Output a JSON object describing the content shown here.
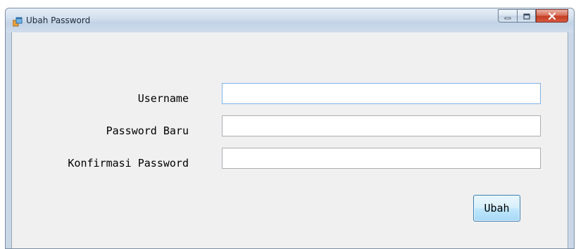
{
  "window": {
    "title": "Ubah Password",
    "icon": "app-window-icon",
    "controls": {
      "minimize_icon": "minimize-icon",
      "maximize_icon": "maximize-icon",
      "close_icon": "close-icon"
    }
  },
  "form": {
    "fields": [
      {
        "label": "Username",
        "value": "",
        "placeholder": ""
      },
      {
        "label": "Password Baru",
        "value": "",
        "placeholder": ""
      },
      {
        "label": "Konfirmasi Password",
        "value": "",
        "placeholder": ""
      }
    ],
    "submit_label": "Ubah"
  },
  "colors": {
    "client_background": "#f0f0f0",
    "close_button": "#c43d23",
    "button_border": "#3c7fb1"
  }
}
